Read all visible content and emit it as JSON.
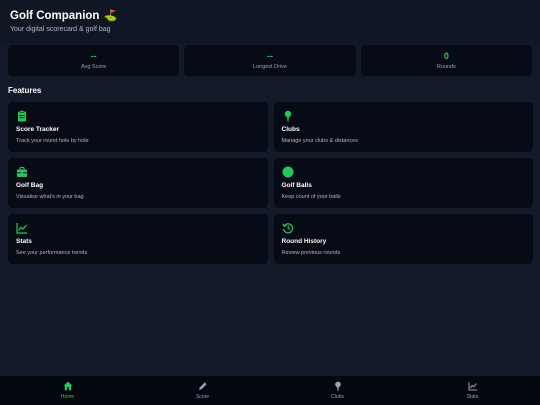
{
  "header": {
    "title": "Golf Companion",
    "title_emoji": "⛳",
    "subtitle": "Your digital scorecard & golf bag"
  },
  "stats": [
    {
      "value": "--",
      "label": "Avg Score"
    },
    {
      "value": "--",
      "label": "Longest Drive"
    },
    {
      "value": "0",
      "label": "Rounds"
    }
  ],
  "features": {
    "section_title": "Features",
    "items": [
      {
        "icon": "clipboard-icon",
        "title": "Score Tracker",
        "desc": "Track your round hole by hole"
      },
      {
        "icon": "golf-tee-icon",
        "title": "Clubs",
        "desc": "Manage your clubs & distances"
      },
      {
        "icon": "briefcase-icon",
        "title": "Golf Bag",
        "desc": "Visualise what's in your bag"
      },
      {
        "icon": "golf-ball-icon",
        "title": "Golf Balls",
        "desc": "Keep count of your balls"
      },
      {
        "icon": "line-chart-icon",
        "title": "Stats",
        "desc": "See your performance trends"
      },
      {
        "icon": "history-icon",
        "title": "Round History",
        "desc": "Review previous rounds"
      }
    ]
  },
  "nav": {
    "items": [
      {
        "icon": "home-icon",
        "label": "Home",
        "active": true
      },
      {
        "icon": "pencil-icon",
        "label": "Score",
        "active": false
      },
      {
        "icon": "golf-tee-icon",
        "label": "Clubs",
        "active": false
      },
      {
        "icon": "line-chart-icon",
        "label": "Stats",
        "active": false
      }
    ]
  },
  "colors": {
    "accent": "#22c55e",
    "background": "#121a29",
    "card": "#060b16",
    "nav_background": "#03070f"
  }
}
